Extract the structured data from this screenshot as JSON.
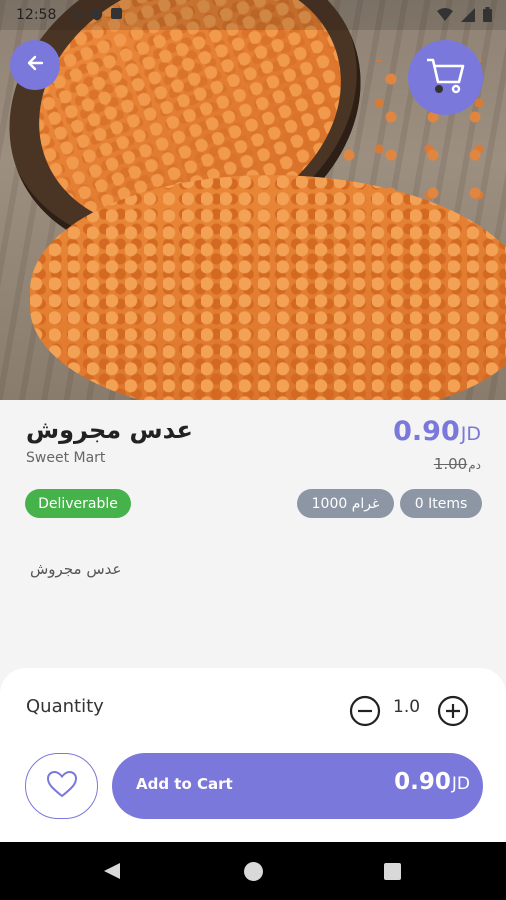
{
  "status_bar": {
    "time": "12:58"
  },
  "product": {
    "name": "عدس مجروش",
    "store": "Sweet Mart",
    "price": "0.90",
    "price_currency": "JD",
    "old_price": "1.00",
    "old_price_currency": "دم",
    "badges": {
      "deliverable": "Deliverable",
      "weight": "غرام 1000",
      "items": "0 Items"
    },
    "description": "عدس مجروش"
  },
  "cart_sheet": {
    "quantity_label": "Quantity",
    "quantity_value": "1.0",
    "add_to_cart_label": "Add to Cart",
    "total_price": "0.90",
    "total_currency": "JD"
  },
  "colors": {
    "accent": "#7b78db",
    "deliverable_green": "#46b24a",
    "badge_gray": "#8c96a4"
  },
  "icons": {
    "back": "arrow-left-icon",
    "cart": "shopping-cart-icon",
    "favorite": "heart-outline-icon",
    "minus": "minus-circle-icon",
    "plus": "plus-circle-icon"
  }
}
